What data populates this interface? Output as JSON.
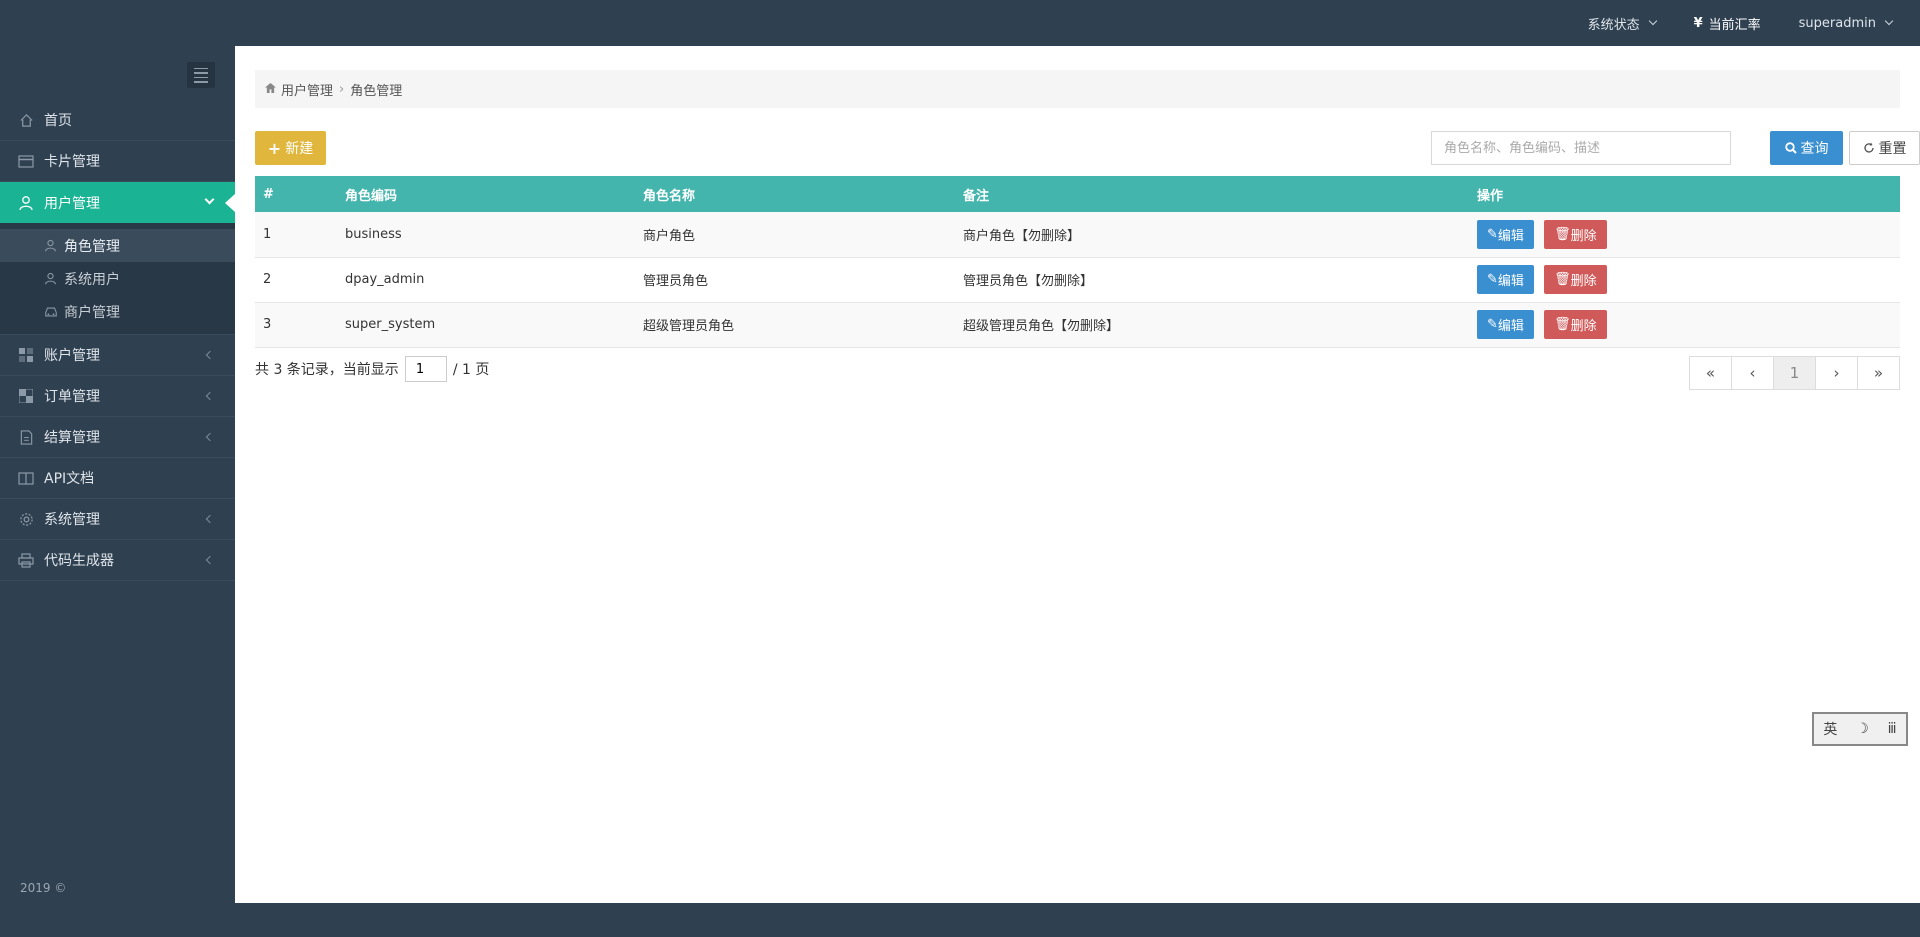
{
  "topbar": {
    "system_status": "系统状态",
    "exchange_rate_symbol": "¥",
    "exchange_rate": "当前汇率",
    "user": "superadmin"
  },
  "sidebar": {
    "items": [
      {
        "label": "首页",
        "icon": "home-icon"
      },
      {
        "label": "卡片管理",
        "icon": "card-icon"
      },
      {
        "label": "用户管理",
        "icon": "user-icon",
        "active": true
      },
      {
        "label": "账户管理",
        "icon": "grid-icon"
      },
      {
        "label": "订单管理",
        "icon": "checker-icon"
      },
      {
        "label": "结算管理",
        "icon": "document-icon"
      },
      {
        "label": "API文档",
        "icon": "book-icon"
      },
      {
        "label": "系统管理",
        "icon": "gear-icon"
      },
      {
        "label": "代码生成器",
        "icon": "printer-icon"
      }
    ],
    "subitems": [
      {
        "label": "角色管理",
        "icon": "user-outline-icon",
        "current": true
      },
      {
        "label": "系统用户",
        "icon": "user-outline-icon"
      },
      {
        "label": "商户管理",
        "icon": "car-icon"
      }
    ],
    "footer": "2019 ©"
  },
  "breadcrumb": {
    "parent": "用户管理",
    "separator": "›",
    "current": "角色管理"
  },
  "toolbar": {
    "new_label": "新建",
    "search_placeholder": "角色名称、角色编码、描述",
    "query_label": "查询",
    "reset_label": "重置"
  },
  "table": {
    "headers": [
      "#",
      "角色编码",
      "角色名称",
      "备注",
      "操作"
    ],
    "rows": [
      {
        "index": "1",
        "code": "business",
        "name": "商户角色",
        "remark": "商户角色【勿删除】"
      },
      {
        "index": "2",
        "code": "dpay_admin",
        "name": "管理员角色",
        "remark": "管理员角色【勿删除】"
      },
      {
        "index": "3",
        "code": "super_system",
        "name": "超级管理员角色",
        "remark": "超级管理员角色【勿删除】"
      }
    ],
    "edit_label": "编辑",
    "delete_label": "删除"
  },
  "pager": {
    "prefix": "共 3 条记录，当前显示",
    "current_page": "1",
    "suffix": "/ 1 页",
    "buttons": [
      "«",
      "‹",
      "1",
      "›",
      "»"
    ]
  },
  "ime": {
    "chars": [
      "英",
      "☽",
      "ⅲ"
    ]
  }
}
